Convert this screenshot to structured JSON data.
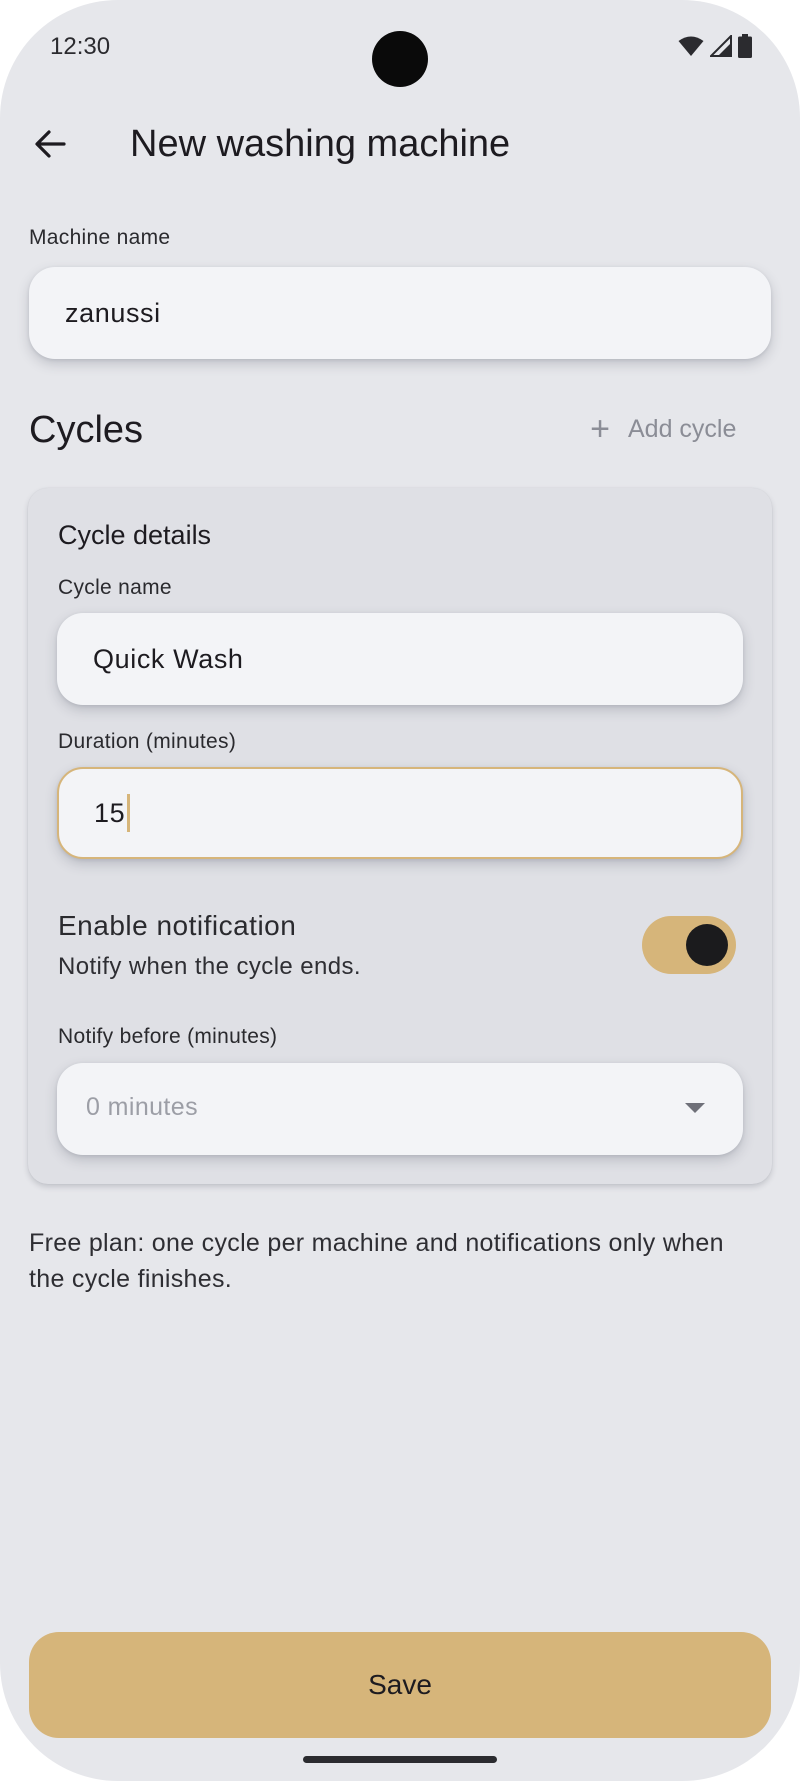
{
  "status_bar": {
    "time": "12:30",
    "icons": [
      "wifi-icon",
      "cellular-signal-icon",
      "battery-icon"
    ]
  },
  "app_bar": {
    "back_icon": "arrow-left-icon",
    "title": "New washing machine"
  },
  "machine": {
    "label": "Machine name",
    "value": "zanussi"
  },
  "cycles": {
    "title": "Cycles",
    "add_label": "Add cycle",
    "add_icon": "plus-icon",
    "card": {
      "title": "Cycle details",
      "cycle_name_label": "Cycle name",
      "cycle_name_value": "Quick Wash",
      "duration_label": "Duration (minutes)",
      "duration_value": "15",
      "notification_title": "Enable notification",
      "notification_subtitle": "Notify when the cycle ends.",
      "notification_enabled": true,
      "notify_before_label": "Notify before (minutes)",
      "notify_before_value": "0 minutes"
    }
  },
  "plan_note": "Free plan: one cycle per machine and notifications only when the cycle finishes.",
  "save_label": "Save",
  "colors": {
    "background": "#e6e7eb",
    "card": "#dfe0e5",
    "field": "#f3f4f7",
    "accent": "#d6b57a",
    "muted_text": "#8b8d96"
  }
}
